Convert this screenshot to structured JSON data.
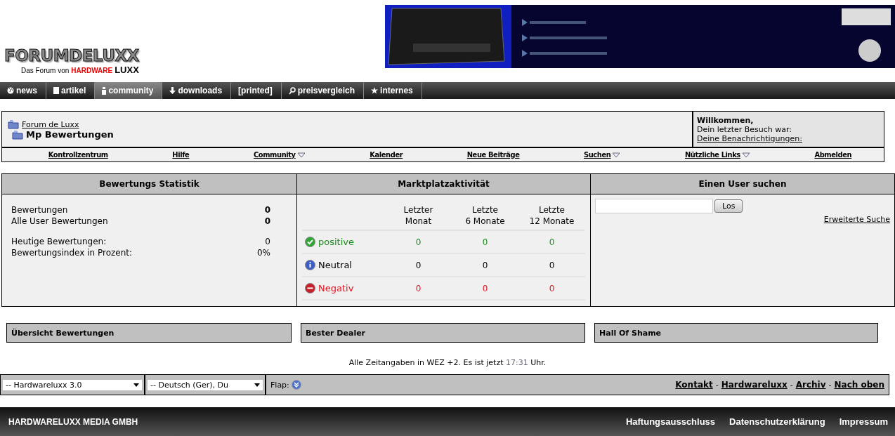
{
  "header": {
    "logo": "FORUMDELUXX",
    "tagline": "Das Forum von",
    "brand_red": "HARDWARE",
    "brand_black": "LUXX"
  },
  "nav": [
    {
      "label": "news",
      "kind": "globe",
      "selected": false
    },
    {
      "label": "artikel",
      "kind": "page",
      "selected": false
    },
    {
      "label": "community",
      "kind": "person",
      "selected": true
    },
    {
      "label": "downloads",
      "kind": "down",
      "selected": false
    },
    {
      "label": "[printed]",
      "kind": "plain",
      "selected": false
    },
    {
      "label": "preisvergleich",
      "kind": "search",
      "selected": false
    },
    {
      "label": "internes",
      "kind": "star",
      "selected": false
    }
  ],
  "breadcrumb": {
    "parent": "Forum de Luxx",
    "current": "Mp Bewertungen"
  },
  "welcome": {
    "title": "Willkommen,",
    "last_visit": "Dein letzter Besuch war:",
    "notifications": "Deine Benachrichtigungen:"
  },
  "navbar": [
    {
      "label": "Kontrollzentrum",
      "menu": false
    },
    {
      "label": "Hilfe",
      "menu": false
    },
    {
      "label": "Community",
      "menu": true
    },
    {
      "label": "Kalender",
      "menu": false
    },
    {
      "label": "Neue Beiträge",
      "menu": false
    },
    {
      "label": "Suchen",
      "menu": true
    },
    {
      "label": "Nützliche Links",
      "menu": true
    },
    {
      "label": "Abmelden",
      "menu": false
    }
  ],
  "statistics": {
    "title": "Bewertungs Statistik",
    "groups": [
      [
        {
          "label": "Bewertungen",
          "value": "0",
          "bold": true
        },
        {
          "label": "Alle User Bewertungen",
          "value": "0",
          "bold": true
        }
      ],
      [
        {
          "label": "Heutige Bewertungen:",
          "value": "0",
          "bold": false
        },
        {
          "label": "Bewertungsindex in Prozent:",
          "value": "0%",
          "bold": false
        }
      ]
    ]
  },
  "market": {
    "title": "Marktplatzaktivität",
    "columns": [
      [
        "Letzter",
        "Monat"
      ],
      [
        "Letzte",
        "6 Monate"
      ],
      [
        "Letzte",
        "12 Monate"
      ]
    ],
    "rows": [
      {
        "kind": "positive",
        "label": "positive",
        "values": [
          "0",
          "0",
          "0"
        ]
      },
      {
        "kind": "neutral",
        "label": "Neutral",
        "values": [
          "0",
          "0",
          "0"
        ]
      },
      {
        "kind": "negative",
        "label": "Negativ",
        "values": [
          "0",
          "0",
          "0"
        ]
      }
    ]
  },
  "user_search": {
    "title": "Einen User suchen",
    "button": "Los",
    "link": "Erweiterte Suche"
  },
  "sections": [
    "Übersicht Bewertungen",
    "Bester Dealer",
    "Hall Of Shame"
  ],
  "time_note": {
    "before": "Alle Zeitangaben in WEZ +2. Es ist jetzt",
    "time": "17:31",
    "after": "Uhr."
  },
  "bottom_bar": {
    "style_select": "-- Hardwareluxx 3.0",
    "language_select": "-- Deutsch (Ger), Du",
    "flap": "Flap:",
    "separator": "-",
    "links": [
      "Kontakt",
      "Hardwareluxx",
      "Archiv",
      "Nach oben"
    ]
  },
  "footer": {
    "company": "HARDWARELUXX MEDIA GMBH",
    "links": [
      "Haftungsausschluss",
      "Datenschutzerklärung",
      "Impressum"
    ]
  }
}
